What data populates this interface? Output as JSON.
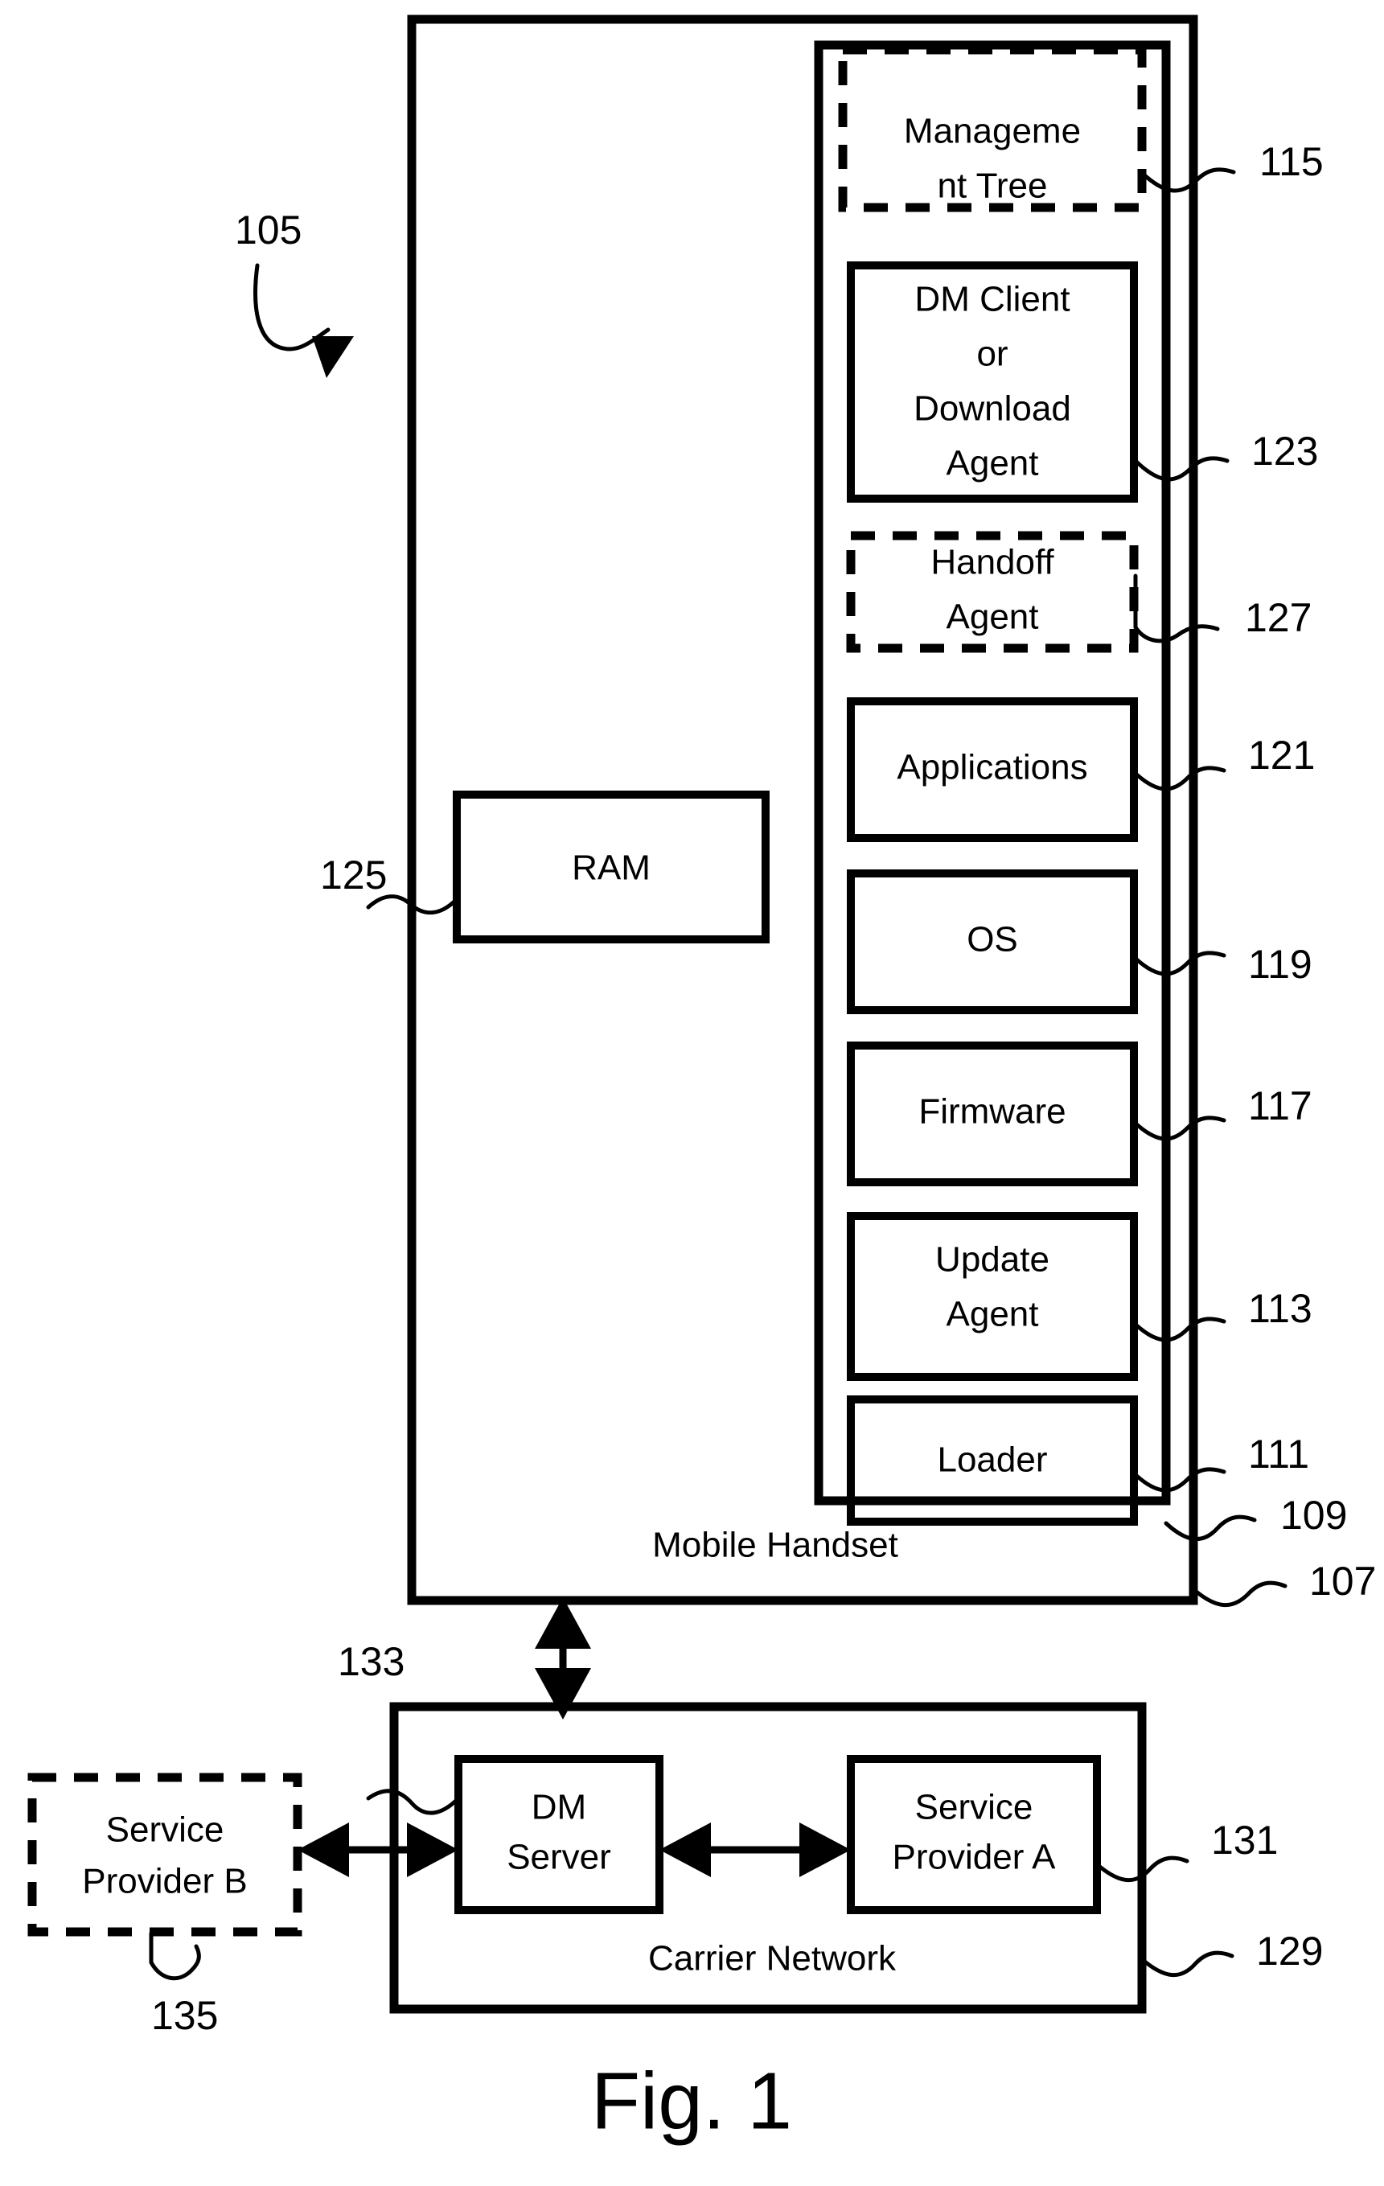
{
  "figure": {
    "caption": "Fig. 1"
  },
  "system": {
    "label_105": "105"
  },
  "handset": {
    "name": "Mobile Handset",
    "ref_outer": "107",
    "ref_inner": "109",
    "ram": {
      "label": "RAM",
      "ref": "125"
    },
    "components": [
      {
        "label_line1": "Manageme",
        "label_line2": "nt Tree",
        "ref": "115",
        "style": "dashed"
      },
      {
        "label_line1": "DM Client",
        "label_line2": "or",
        "label_line3": "Download",
        "label_line4": "Agent",
        "ref": "123",
        "style": "solid"
      },
      {
        "label_line1": "Handoff",
        "label_line2": "Agent",
        "ref": "127",
        "style": "dashed"
      },
      {
        "label_line1": "Applications",
        "ref": "121",
        "style": "solid"
      },
      {
        "label_line1": "OS",
        "ref": "119",
        "style": "solid"
      },
      {
        "label_line1": "Firmware",
        "ref": "117",
        "style": "solid"
      },
      {
        "label_line1": "Update",
        "label_line2": "Agent",
        "ref": "113",
        "style": "solid"
      },
      {
        "label_line1": "Loader",
        "ref": "111",
        "style": "solid"
      }
    ]
  },
  "carrier_network": {
    "name": "Carrier Network",
    "ref": "129",
    "dm_server": {
      "label_line1": "DM",
      "label_line2": "Server",
      "ref": "133"
    },
    "service_provider_a": {
      "label_line1": "Service",
      "label_line2": "Provider A",
      "ref": "131"
    }
  },
  "service_provider_b": {
    "label_line1": "Service",
    "label_line2": "Provider B",
    "ref": "135",
    "style": "dashed"
  }
}
